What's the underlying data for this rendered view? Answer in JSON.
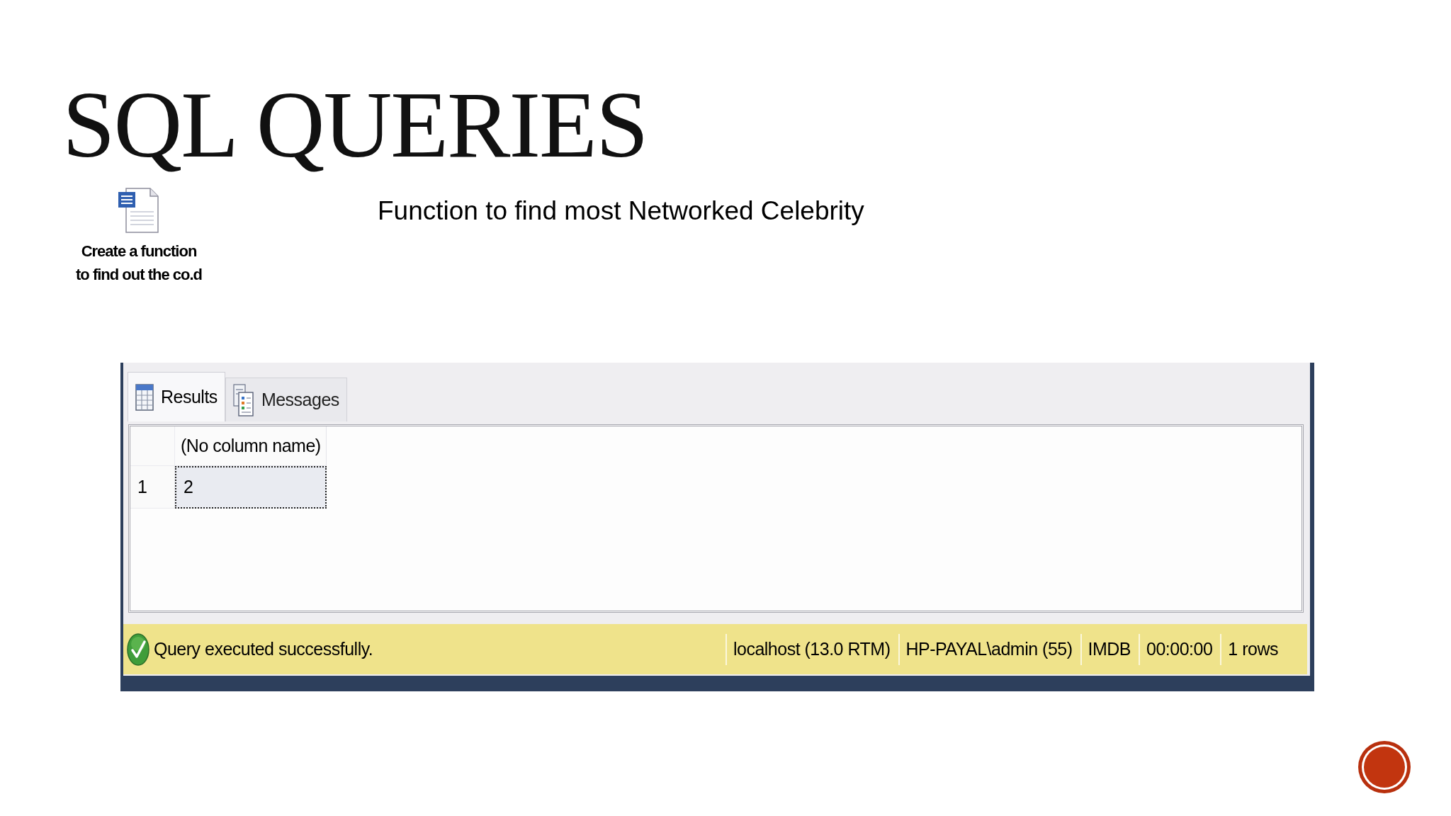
{
  "slide": {
    "title": "SQL QUERIES",
    "subtitle": "Function to find most Networked Celebrity"
  },
  "attachment": {
    "label_lines": [
      "Create a function",
      "to find out the co.d"
    ]
  },
  "results_pane": {
    "tabs": [
      {
        "label": "Results",
        "selected": true
      },
      {
        "label": "Messages",
        "selected": false
      }
    ],
    "grid": {
      "columns": [
        "(No column name)"
      ],
      "rows": [
        {
          "number": "1",
          "cells": [
            {
              "value": "2",
              "selected": true
            }
          ]
        }
      ]
    },
    "status_bar": {
      "message": "Query executed successfully.",
      "fields": [
        "localhost (13.0 RTM)",
        "HP-PAYAL\\admin (55)",
        "IMDB",
        "00:00:00",
        "1 rows"
      ]
    }
  }
}
